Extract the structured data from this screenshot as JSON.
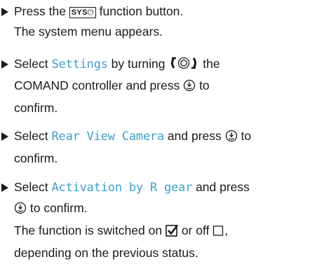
{
  "steps": [
    {
      "a": "Press the ",
      "key_label": "SYS",
      "b": " function button.",
      "result": "The system menu appears."
    },
    {
      "a": "Select ",
      "term": "Settings",
      "b": " by turning ",
      "c": " the",
      "line2": "COMAND controller and press ",
      "d": " to",
      "line3": "confirm."
    },
    {
      "a": "Select ",
      "term": "Rear View Camera",
      "b": " and press ",
      "c": " to",
      "line2": "confirm."
    },
    {
      "a": "Select ",
      "term": "Activation by R gear",
      "b": " and press",
      "line2_b": " to confirm.",
      "result_a": "The function is switched on ",
      "result_b": " or off ",
      "result_c": ",",
      "result_line2": "depending on the previous status."
    }
  ],
  "colors": {
    "term": "#3c9fce",
    "text": "#1a1a1a"
  },
  "icons": [
    "bullet-triangle",
    "sys-button",
    "power-icon",
    "controller-rotate-icon",
    "controller-press-icon",
    "checkbox-checked-icon",
    "checkbox-empty-icon"
  ]
}
